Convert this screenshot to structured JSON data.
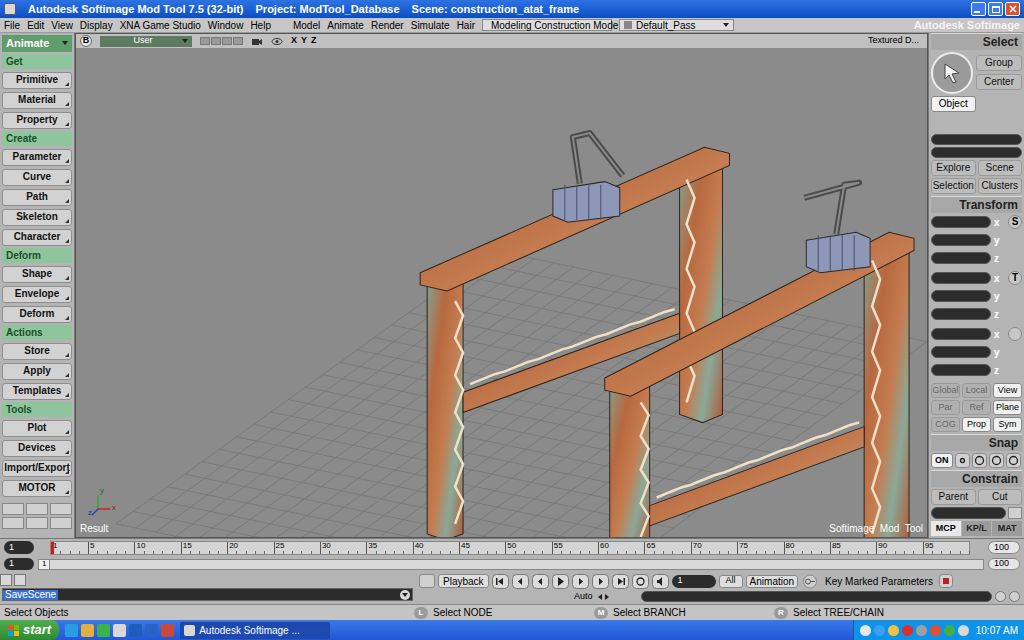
{
  "window": {
    "title": "Autodesk Softimage Mod Tool 7.5 (32-bit)",
    "project": "Project: ModTool_Database",
    "scene": "Scene: construction_atat_frame"
  },
  "menu_bar": {
    "items": [
      "File",
      "Edit",
      "View",
      "Display",
      "XNA Game Studio",
      "Window",
      "Help"
    ],
    "modules": [
      "Model",
      "Animate",
      "Render",
      "Simulate",
      "Hair"
    ],
    "mode": "Modeling Construction Mode",
    "pass": "Default_Pass",
    "brand": "Autodesk Softimage"
  },
  "left_panel": {
    "module": "Animate",
    "sections": [
      {
        "title": "Get",
        "buttons": [
          "Primitive",
          "Material",
          "Property"
        ]
      },
      {
        "title": "Create",
        "buttons": [
          "Parameter",
          "Curve",
          "Path",
          "Skeleton",
          "Character"
        ]
      },
      {
        "title": "Deform",
        "buttons": [
          "Shape",
          "Envelope",
          "Deform"
        ]
      },
      {
        "title": "Actions",
        "buttons": [
          "Store",
          "Apply",
          "Templates"
        ]
      },
      {
        "title": "Tools",
        "buttons": [
          "Plot",
          "Devices",
          "Import/Export",
          "MOTOR"
        ]
      }
    ]
  },
  "viewport": {
    "view_letter": "B",
    "camera": "User",
    "axes": [
      "X",
      "Y",
      "Z"
    ],
    "display_mode": "Textured D...",
    "result_label": "Result",
    "watermark": "Softimage  Mod  Tool",
    "axis_gizmo": [
      "y",
      "x",
      "z"
    ]
  },
  "right_panel": {
    "select": {
      "title": "Select",
      "buttons": [
        "Group",
        "Center"
      ],
      "filters": [
        {
          "label": "Object",
          "selected": true
        }
      ],
      "explore_buttons": [
        "Explore",
        "Scene",
        "Selection",
        "Clusters"
      ]
    },
    "transform": {
      "title": "Transform",
      "groups": [
        {
          "key": "S",
          "axes": [
            "x",
            "y",
            "z"
          ]
        },
        {
          "key": "T",
          "axes": [
            "x",
            "y",
            "z"
          ]
        },
        {
          "key": "",
          "axes": [
            "x",
            "y",
            "z"
          ]
        }
      ],
      "modes": [
        {
          "label": "Global",
          "selected": false
        },
        {
          "label": "Local",
          "selected": false
        },
        {
          "label": "View",
          "selected": true
        },
        {
          "label": "Par",
          "selected": false
        },
        {
          "label": "Ref",
          "selected": false
        },
        {
          "label": "Plane",
          "selected": true
        },
        {
          "label": "COG",
          "selected": false
        },
        {
          "label": "Prop",
          "selected": true
        },
        {
          "label": "Sym",
          "selected": true
        }
      ]
    },
    "snap": {
      "title": "Snap",
      "on": "ON"
    },
    "constrain": {
      "title": "Constrain",
      "buttons": [
        "Parent",
        "Cut"
      ]
    },
    "tabs": [
      {
        "label": "MCP",
        "selected": true
      },
      {
        "label": "KP/L",
        "selected": false
      },
      {
        "label": "MAT",
        "selected": false
      }
    ]
  },
  "timeline": {
    "ticks": [
      "1",
      "5",
      "10",
      "15",
      "20",
      "25",
      "30",
      "35",
      "40",
      "45",
      "50",
      "55",
      "60",
      "65",
      "70",
      "75",
      "80",
      "85",
      "90",
      "95"
    ],
    "current_frame": "1",
    "start_fields": [
      "1",
      "1"
    ],
    "end_fields": [
      "100",
      "100"
    ],
    "range_marker": "1"
  },
  "command_bar": {
    "command": "SaveScene",
    "playback": "Playback",
    "frame": "1",
    "all": "All",
    "animation": "Animation",
    "auto": "Auto",
    "key_marked": "Key Marked Parameters"
  },
  "status_bar": {
    "message": "Select Objects",
    "mouse_hints": [
      {
        "button": "L",
        "text": "Select NODE"
      },
      {
        "button": "M",
        "text": "Select BRANCH"
      },
      {
        "button": "R",
        "text": "Select TREE/CHAIN"
      }
    ]
  },
  "taskbar": {
    "start": "start",
    "tasks": [
      {
        "label": "Autodesk Softimage ...",
        "selected": true
      }
    ],
    "clock": "10:07 AM"
  }
}
